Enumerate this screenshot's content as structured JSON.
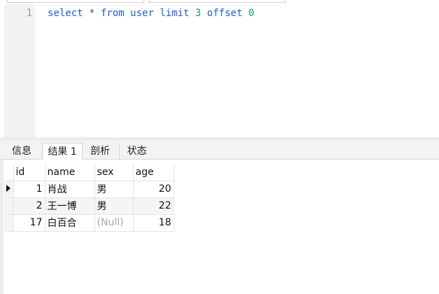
{
  "editor": {
    "line_number": "1",
    "query": {
      "t1": "select",
      "t2": "*",
      "t3": "from",
      "t4": "user",
      "t5": "limit",
      "t6": "3",
      "t7": "offset",
      "t8": "0"
    }
  },
  "tabs": [
    {
      "label": "信息"
    },
    {
      "label": "结果 1"
    },
    {
      "label": "剖析"
    },
    {
      "label": "状态"
    }
  ],
  "table": {
    "columns": [
      "id",
      "name",
      "sex",
      "age"
    ],
    "rows": [
      {
        "id": "1",
        "name": "肖战",
        "sex": "男",
        "age": "20"
      },
      {
        "id": "2",
        "name": "王一博",
        "sex": "男",
        "age": "22"
      },
      {
        "id": "17",
        "name": "白百合",
        "sex": "(Null)",
        "age": "18"
      }
    ]
  },
  "colors": {
    "keyword": "#1f5bd6",
    "number": "#0aa06e",
    "null_text": "#a8a8a8",
    "selected_header": "#dcebfb"
  }
}
